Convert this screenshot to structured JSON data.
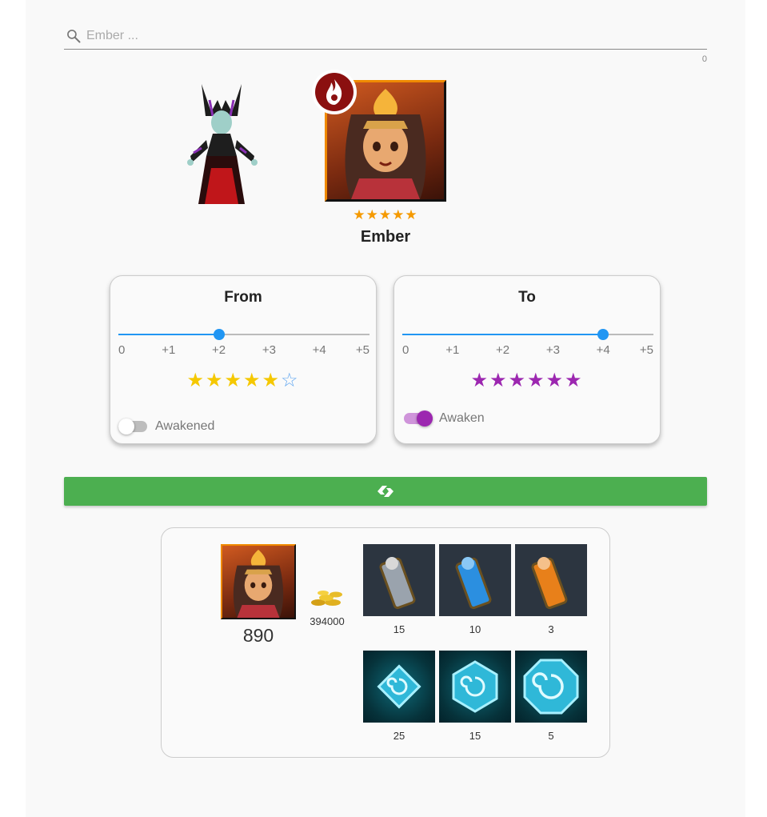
{
  "search": {
    "placeholder": "Ember ...",
    "value": "",
    "char_count": "0"
  },
  "hero": {
    "name": "Ember",
    "stars": "★★★★★",
    "element": "fire-icon"
  },
  "from_card": {
    "title": "From",
    "slider_value": "+2",
    "ticks": [
      "0",
      "+1",
      "+2",
      "+3",
      "+4",
      "+5"
    ],
    "stars_filled": "★★★★★",
    "stars_empty": "☆",
    "toggle_label": "Awakened",
    "toggle_on": false
  },
  "to_card": {
    "title": "To",
    "slider_value": "+4",
    "ticks": [
      "0",
      "+1",
      "+2",
      "+3",
      "+4",
      "+5"
    ],
    "stars_filled": "★★★★★★",
    "toggle_label": "Awaken",
    "toggle_on": true
  },
  "convert_button": {
    "icon": "convert-icon"
  },
  "results": {
    "hero_count": "890",
    "gold": "394000",
    "scrolls": [
      {
        "name": "scroll-silver-icon",
        "qty": "15"
      },
      {
        "name": "scroll-blue-icon",
        "qty": "10"
      },
      {
        "name": "scroll-orange-icon",
        "qty": "3"
      }
    ],
    "runes": [
      {
        "name": "rune-small-icon",
        "qty": "25"
      },
      {
        "name": "rune-medium-icon",
        "qty": "15"
      },
      {
        "name": "rune-large-icon",
        "qty": "5"
      }
    ]
  },
  "colors": {
    "accent_blue": "#2196f3",
    "star_gold": "#f5c800",
    "star_purple": "#9c27b0",
    "button_green": "#4caf50",
    "hero_star_orange": "#f59a00"
  }
}
